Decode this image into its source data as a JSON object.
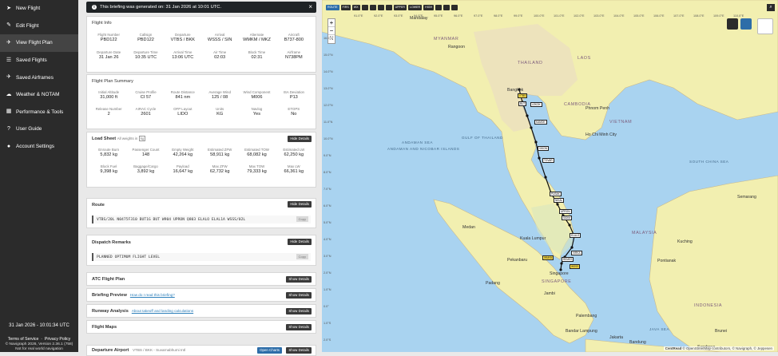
{
  "sidebar": {
    "items": [
      {
        "label": "New Flight",
        "icon": "paper-plane-icon"
      },
      {
        "label": "Edit Flight",
        "icon": "edit-icon"
      },
      {
        "label": "View Flight Plan",
        "icon": "plane-icon"
      },
      {
        "label": "Saved Flights",
        "icon": "list-icon"
      },
      {
        "label": "Saved Airframes",
        "icon": "airplane-icon"
      },
      {
        "label": "Weather & NOTAM",
        "icon": "cloud-icon"
      },
      {
        "label": "Performance & Tools",
        "icon": "calculator-icon"
      },
      {
        "label": "User Guide",
        "icon": "help-icon"
      },
      {
        "label": "Account Settings",
        "icon": "user-icon"
      }
    ],
    "datetime": "31 Jan 2026 - 10:01:34 UTC",
    "terms": "Terms of Service",
    "privacy": "Privacy Policy",
    "copyright": "© Navigraph 2026, Version 2.36.1 (758)",
    "disclaimer": "Not for real world navigation"
  },
  "banner": {
    "text": "This briefing was generated on: 31 Jan 2026 at 10:01 UTC.",
    "close": "×"
  },
  "flight_info": {
    "title": "Flight Info",
    "rows": [
      [
        {
          "label": "Flight Number",
          "value": "PBD122"
        },
        {
          "label": "Callsign",
          "value": "PBD122"
        },
        {
          "label": "Departure",
          "value": "VTBS / BKK"
        },
        {
          "label": "Arrival",
          "value": "WSSS / SIN"
        },
        {
          "label": "Alternate",
          "value": "WMKM / MKZ"
        },
        {
          "label": "Aircraft",
          "value": "B737-800"
        }
      ],
      [
        {
          "label": "Departure Date",
          "value": "31 Jan 26"
        },
        {
          "label": "Departure Time",
          "value": "10:35 UTC"
        },
        {
          "label": "Arrival Time",
          "value": "13:06 UTC"
        },
        {
          "label": "Air Time",
          "value": "02:03"
        },
        {
          "label": "Block Time",
          "value": "02:31"
        },
        {
          "label": "Airframe",
          "value": "N738PM"
        }
      ]
    ]
  },
  "plan_summary": {
    "title": "Flight Plan Summary",
    "rows": [
      [
        {
          "label": "Initial Altitude",
          "value": "31,000 ft"
        },
        {
          "label": "Cruise Profile",
          "value": "CI 57"
        },
        {
          "label": "Route Distance",
          "value": "841 nm"
        },
        {
          "label": "Average Wind",
          "value": "125 / 08"
        },
        {
          "label": "Wind Component",
          "value": "M006"
        },
        {
          "label": "ISA Deviation",
          "value": "P13"
        }
      ],
      [
        {
          "label": "Release Number",
          "value": "2"
        },
        {
          "label": "AIRAC Cycle",
          "value": "2601"
        },
        {
          "label": "OFP Layout",
          "value": "LIDO"
        },
        {
          "label": "Units",
          "value": "KG"
        },
        {
          "label": "Navlog",
          "value": "Yes"
        },
        {
          "label": "ETOPS",
          "value": "No"
        }
      ]
    ]
  },
  "load_sheet": {
    "title": "Load Sheet",
    "note": "All weights in",
    "unit": "kg",
    "button": "Hide Details",
    "rows": [
      [
        {
          "label": "Enroute Burn",
          "value": "5,832 kg"
        },
        {
          "label": "Passenger Count",
          "value": "148"
        },
        {
          "label": "Empty Weight",
          "value": "42,264 kg"
        },
        {
          "label": "Estimated ZFW",
          "value": "58,911 kg"
        },
        {
          "label": "Estimated TOW",
          "value": "68,082 kg"
        },
        {
          "label": "Estimated LW",
          "value": "62,250 kg"
        }
      ],
      [
        {
          "label": "Block Fuel",
          "value": "9,398 kg"
        },
        {
          "label": "Baggage/Cargo",
          "value": "3,892 kg"
        },
        {
          "label": "Payload",
          "value": "16,647 kg"
        },
        {
          "label": "Max ZFW",
          "value": "62,732 kg"
        },
        {
          "label": "Max TOW",
          "value": "79,333 kg"
        },
        {
          "label": "Max LW",
          "value": "66,361 kg"
        }
      ]
    ]
  },
  "route": {
    "title": "Route",
    "button": "Hide Details",
    "text": "VTBS/20L N0475F310 BUT1G BUT W904 UPRON Q803 ELALO ELAL1A WSSS/02L",
    "copy": "Copy"
  },
  "dispatch": {
    "title": "Dispatch Remarks",
    "button": "Hide Details",
    "text": "PLANNED OPTIMUM FLIGHT LEVEL",
    "copy": "Copy"
  },
  "collapsed_sections": [
    {
      "title": "ATC Flight Plan",
      "link": "",
      "button": "Show Details"
    },
    {
      "title": "Briefing Preview",
      "link": "How do I read this briefing?",
      "button": "Show Details"
    },
    {
      "title": "Runway Analysis",
      "link": "About takeoff and landing calculations",
      "button": "Show Details"
    },
    {
      "title": "Flight Maps",
      "link": "",
      "button": "Show Details"
    }
  ],
  "departure_airport": {
    "title": "Departure Airport",
    "sub": "VTBS / BKK - Suvarnabhumi Intl",
    "open_button": "Open Charts",
    "button": "Show Details"
  },
  "map": {
    "toolbar": [
      "ROUTE",
      "FIRS",
      "WX",
      "",
      "",
      "",
      "",
      "UPPER",
      "LOWER",
      "HIGH",
      "",
      "",
      ""
    ],
    "zoom_in": "+",
    "zoom_out": "−",
    "fullscreen": "⛶",
    "search": "⌕",
    "attribution": "© OpenStreetMap contributors, © Navigraph, © Jeppesen",
    "logo": "CentRead",
    "latitudes": [
      "16.0°N",
      "15.0°N",
      "14.0°N",
      "13.0°N",
      "12.0°N",
      "11.0°N",
      "10.0°N",
      "9.0°N",
      "8.0°N",
      "7.0°N",
      "6.0°N",
      "5.0°N",
      "4.0°N",
      "3.0°N",
      "2.0°N",
      "1.0°N",
      "0.0°",
      "1.0°S",
      "2.0°S",
      "3.0°S",
      "4.0°S",
      "5.0°S"
    ],
    "longitudes": [
      "91.0°E",
      "92.0°E",
      "93.0°E",
      "94.0°E",
      "95.0°E",
      "96.0°E",
      "97.0°E",
      "98.0°E",
      "99.0°E",
      "100.0°E",
      "101.0°E",
      "102.0°E",
      "103.0°E",
      "104.0°E",
      "105.0°E",
      "106.0°E",
      "107.0°E",
      "108.0°E",
      "109.0°E",
      "110.0°E",
      "111.0°E",
      "112.0°E"
    ],
    "places": [
      "Mandalay",
      "Rangoon",
      "Bangkok",
      "Phnom Penh",
      "Ho Chi Minh City",
      "Kuala Lumpur",
      "Singapore",
      "Pekanbaru",
      "Palembang",
      "Pontianak",
      "Kuching",
      "Medan",
      "Padang",
      "Jambi",
      "Bandar Lampung",
      "Jakarta",
      "Bandung",
      "Surabaya",
      "Semarang",
      "Brunei"
    ],
    "countries": [
      "THAILAND",
      "MYANMAR",
      "CAMBODIA",
      "VIETNAM",
      "LAOS",
      "MALAYSIA",
      "INDONESIA",
      "SINGAPORE"
    ],
    "seas": [
      "ANDAMAN SEA",
      "ANDAMAN AND NICOBAR ISLANDS",
      "GULF OF THAILAND",
      "SOUTH CHINA SEA",
      "JAVA SEA"
    ],
    "waypoints": [
      "VTBS",
      "BUT",
      "LEKOK",
      "KAMOK",
      "VIKON",
      "TOVAR",
      "PUSAK",
      "NIKAL",
      "UPRON",
      "SIDIM",
      "ELALO",
      "VIRKA",
      "WSSS",
      "WMKM",
      "REMES"
    ]
  }
}
